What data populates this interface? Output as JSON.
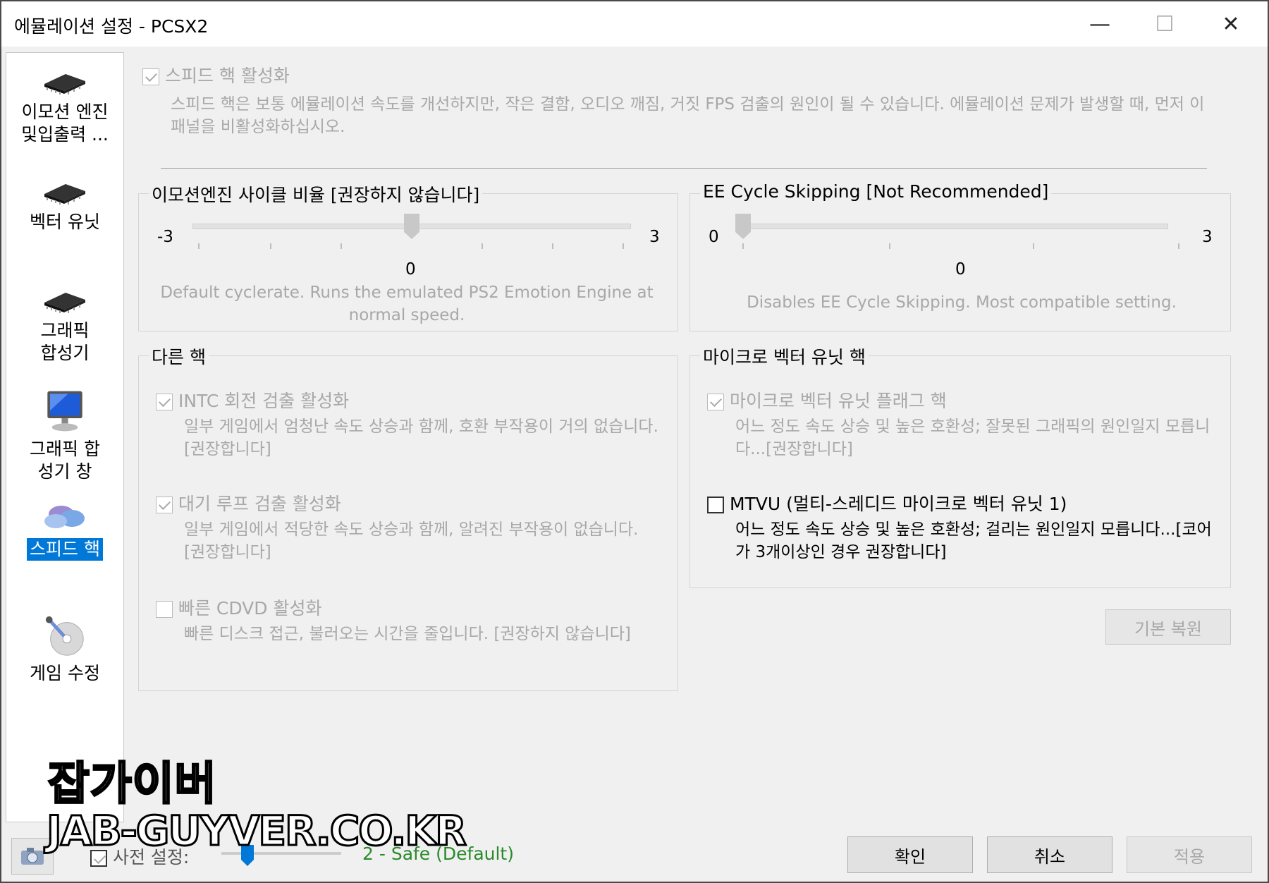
{
  "window": {
    "title": "에뮬레이션 설정 - PCSX2",
    "min": "—",
    "max": "☐",
    "close": "✕"
  },
  "sidebar": {
    "items": [
      {
        "label": "이모션 엔진 및입출력 ...",
        "icon": "chip-icon",
        "selected": false
      },
      {
        "label": "벡터 유닛",
        "icon": "chip-icon",
        "selected": false
      },
      {
        "label": "그래픽 합성기",
        "icon": "chip-icon",
        "selected": false
      },
      {
        "label": "그래픽 합성기 창",
        "icon": "monitor-icon",
        "selected": false
      },
      {
        "label": "스피드 핵",
        "icon": "pills-icon",
        "selected": true
      },
      {
        "label": "게임 수정",
        "icon": "disc-icon",
        "selected": false
      }
    ]
  },
  "speedhack": {
    "enable_label": "스피드 핵 활성화",
    "enable_checked": true,
    "desc": "스피드 핵은 보통 에뮬레이션 속도를 개선하지만, 작은 결함, 오디오 깨짐, 거짓 FPS 검출의 원인이 될 수 있습니다. 에뮬레이션 문제가 발생할 때, 먼저 이 패널을 비활성화하십시오."
  },
  "ee_rate": {
    "title": "이모션엔진 사이클 비율 [권장하지 않습니다]",
    "min": "-3",
    "max": "3",
    "value": "0",
    "position": 0.5,
    "desc": "Default cyclerate. Runs the emulated PS2 Emotion Engine at normal speed."
  },
  "ee_skip": {
    "title": "EE Cycle Skipping [Not Recommended]",
    "min": "0",
    "max": "3",
    "value": "0",
    "position": 0,
    "desc": "Disables EE Cycle Skipping. Most compatible setting."
  },
  "other_hacks": {
    "title": "다른 핵",
    "items": [
      {
        "label": "INTC 회전 검출 활성화",
        "checked": true,
        "desc": "일부 게임에서 엄청난 속도 상승과 함께, 호환 부작용이 거의 없습니다. [권장합니다]"
      },
      {
        "label": "대기 루프 검출 활성화",
        "checked": true,
        "desc": "일부 게임에서 적당한 속도 상승과 함께, 알려진 부작용이 없습니다. [권장합니다]"
      },
      {
        "label": "빠른 CDVD 활성화",
        "checked": false,
        "desc": "빠른 디스크 접근, 불러오는 시간을 줄입니다. [권장하지 않습니다]"
      }
    ]
  },
  "vu_hacks": {
    "title": "마이크로 벡터 유닛 핵",
    "flag_label": "마이크로 벡터 유닛 플래그 핵",
    "flag_checked": true,
    "flag_desc": "어느 정도 속도 상승 및 높은 호환성; 잘못된 그래픽의 원인일지 모릅니다...[권장합니다]",
    "mtvu_label": "MTVU (멀티-스레디드 마이크로 벡터 유닛 1)",
    "mtvu_checked": false,
    "mtvu_desc": "어느 정도 속도 상승 및 높은 호환성; 걸리는 원인일지 모릅니다...[코어가 3개이상인 경우 권장합니다]"
  },
  "restore_default": "기본 복원",
  "footer": {
    "preset_label": "사전 설정:",
    "preset_checked": true,
    "preset_value": "2 - Safe (Default)",
    "ok": "확인",
    "cancel": "취소",
    "apply": "적용"
  },
  "watermark": {
    "line1": "잡가이버",
    "line2": "JAB-GUYVER.CO.KR"
  }
}
